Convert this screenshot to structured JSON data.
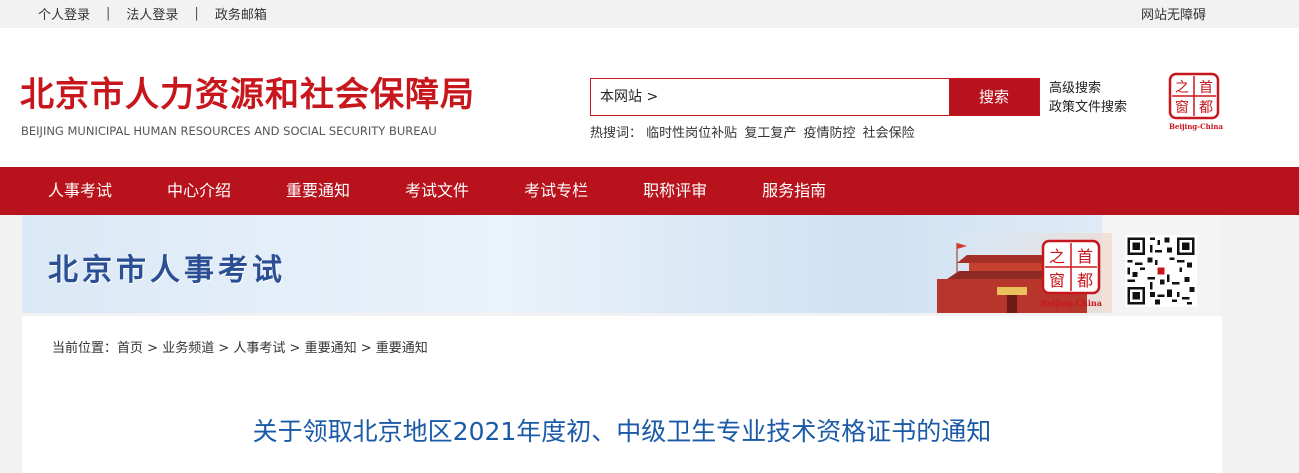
{
  "topbar": {
    "personal_login": "个人登录",
    "sep1": "|",
    "corp_login": "法人登录",
    "sep2": "|",
    "gov_mail": "政务邮箱",
    "accessibility": "网站无障碍"
  },
  "header": {
    "logo_cn": "北京市人力资源和社会保障局",
    "logo_en": "BEIJING MUNICIPAL HUMAN RESOURCES AND SOCIAL SECURITY BUREAU",
    "search_scope": "本网站 >",
    "search_button": "搜索",
    "advanced_search": "高级搜索",
    "policy_search": "政策文件搜索",
    "hot_label": "热搜词：",
    "hot_terms": [
      "临时性岗位补贴",
      "复工复产",
      "疫情防控",
      "社会保险"
    ],
    "capital_logo": {
      "chars": [
        "之",
        "首",
        "窗",
        "都"
      ],
      "caption": "Beijing-China"
    }
  },
  "nav": {
    "items": [
      "人事考试",
      "中心介绍",
      "重要通知",
      "考试文件",
      "考试专栏",
      "职称评审",
      "服务指南"
    ]
  },
  "banner": {
    "title": "北京市人事考试",
    "seal_chars": [
      "之",
      "首",
      "窗",
      "都"
    ],
    "seal_caption": "Beijing-China"
  },
  "breadcrumb": {
    "label": "当前位置：",
    "items": [
      "首页",
      "业务频道",
      "人事考试",
      "重要通知",
      "重要通知"
    ],
    "separator": " > "
  },
  "article": {
    "title": "关于领取北京地区2021年度初、中级卫生专业技术资格证书的通知"
  },
  "colors": {
    "brand_red": "#b8131c",
    "title_blue": "#1a5aa6",
    "banner_blue": "#2b4f95"
  }
}
